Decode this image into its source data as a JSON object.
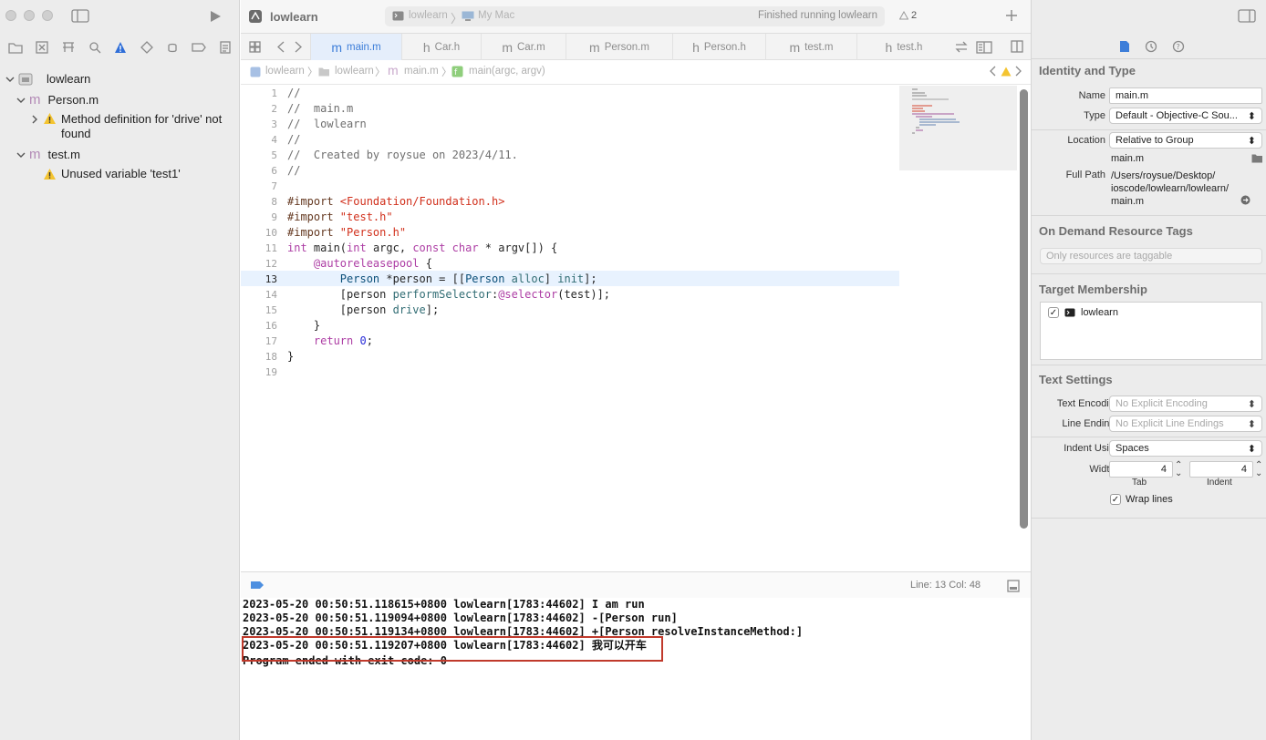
{
  "window": {
    "title": "lowlearn"
  },
  "toolbar": {
    "scheme": "lowlearn",
    "destination": "My Mac",
    "status": "Finished running lowlearn",
    "warning_count": "2"
  },
  "navigator": {
    "items": [
      {
        "label": "lowlearn",
        "icon": "project-icon"
      },
      {
        "label": "Person.m",
        "icon": "objc-file-icon"
      },
      {
        "label": "Method definition for 'drive' not found",
        "icon": "warning-icon"
      },
      {
        "label": "test.m",
        "icon": "objc-file-icon"
      },
      {
        "label": "Unused variable 'test1'",
        "icon": "warning-icon"
      }
    ]
  },
  "tabs": [
    {
      "label": "main.m",
      "prefix": "m",
      "active": true
    },
    {
      "label": "Car.h",
      "prefix": "h"
    },
    {
      "label": "Car.m",
      "prefix": "m"
    },
    {
      "label": "Person.m",
      "prefix": "m"
    },
    {
      "label": "Person.h",
      "prefix": "h"
    },
    {
      "label": "test.m",
      "prefix": "m"
    },
    {
      "label": "test.h",
      "prefix": "h"
    }
  ],
  "jumpbar": [
    "lowlearn",
    "lowlearn",
    "main.m",
    "main(argc, argv)"
  ],
  "editor": {
    "line_numbers": [
      "1",
      "2",
      "3",
      "4",
      "5",
      "6",
      "7",
      "8",
      "9",
      "10",
      "11",
      "12",
      "13",
      "14",
      "15",
      "16",
      "17",
      "18",
      "19"
    ],
    "current_line": 13,
    "cursor": "Line: 13  Col: 48"
  },
  "console": {
    "lines": [
      "2023-05-20 00:50:51.118615+0800 lowlearn[1783:44602] I am run",
      "2023-05-20 00:50:51.119094+0800 lowlearn[1783:44602] -[Person run]",
      "2023-05-20 00:50:51.119134+0800 lowlearn[1783:44602] +[Person resolveInstanceMethod:]",
      "2023-05-20 00:50:51.119207+0800 lowlearn[1783:44602] 我可以开车",
      "Program ended with exit code: 0"
    ],
    "highlight_color": "#c0392b"
  },
  "inspector": {
    "identity": {
      "header": "Identity and Type",
      "name_label": "Name",
      "name_value": "main.m",
      "type_label": "Type",
      "type_value": "Default - Objective-C Sou...",
      "location_label": "Location",
      "location_value": "Relative to Group",
      "file_name": "main.m",
      "fullpath_label": "Full Path",
      "fullpath_value": "/Users/roysue/Desktop/ ioscode/lowlearn/lowlearn/ main.m"
    },
    "tags": {
      "header": "On Demand Resource Tags",
      "placeholder": "Only resources are taggable"
    },
    "target": {
      "header": "Target Membership",
      "item": "lowlearn"
    },
    "text": {
      "header": "Text Settings",
      "encoding_label": "Text Encoding",
      "encoding_value": "No Explicit Encoding",
      "endings_label": "Line Endings",
      "endings_value": "No Explicit Line Endings",
      "indent_label": "Indent Using",
      "indent_value": "Spaces",
      "widths_label": "Widths",
      "tab_value": "4",
      "indent_value_num": "4",
      "tab_label": "Tab",
      "indent_sublabel": "Indent",
      "wrap_label": "Wrap lines"
    }
  }
}
